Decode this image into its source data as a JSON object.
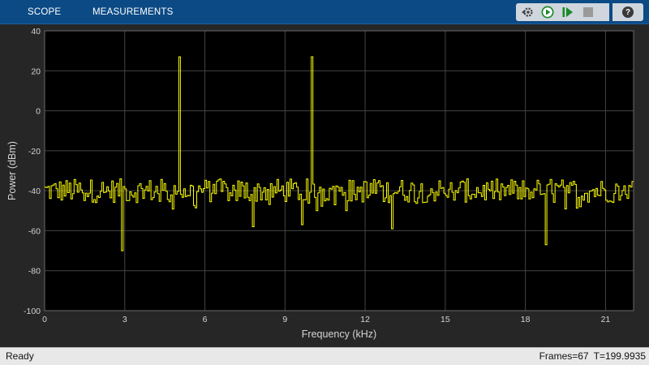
{
  "toolbar": {
    "tabs": [
      {
        "label": "SCOPE"
      },
      {
        "label": "MEASUREMENTS"
      }
    ],
    "buttons": [
      {
        "icon": "settings-gear-icon"
      },
      {
        "icon": "run-icon"
      },
      {
        "icon": "step-forward-icon"
      },
      {
        "icon": "stop-icon"
      },
      {
        "icon": "help-icon",
        "label": "?"
      }
    ],
    "colors": {
      "bar": "#0b4a85",
      "run": "#1a8a2a",
      "stop": "#9a9a9a"
    }
  },
  "status": {
    "left": "Ready",
    "frames": "Frames=67",
    "time": "T=199.9935"
  },
  "chart_data": {
    "type": "line",
    "xlabel": "Frequency (kHz)",
    "ylabel": "Power (dBm)",
    "xlim": [
      0,
      22.05
    ],
    "ylim": [
      -100,
      40
    ],
    "xticks": [
      0,
      3,
      6,
      9,
      12,
      15,
      18,
      21
    ],
    "yticks": [
      40,
      20,
      0,
      -20,
      -40,
      -60,
      -80,
      -100
    ],
    "grid": true,
    "line_color": "#ffff00",
    "background": "#000000",
    "series": [
      {
        "style": "stairs",
        "noise_floor_dBm": -40,
        "noise_range_dBm": [
          -50,
          -32
        ],
        "peaks": [
          {
            "x": 5.0,
            "y": 27
          },
          {
            "x": 10.0,
            "y": 27
          }
        ],
        "dips": [
          {
            "x": 2.9,
            "y": -70
          },
          {
            "x": 7.8,
            "y": -58
          },
          {
            "x": 9.6,
            "y": -57
          },
          {
            "x": 13.0,
            "y": -59
          },
          {
            "x": 18.75,
            "y": -67
          }
        ]
      }
    ]
  }
}
